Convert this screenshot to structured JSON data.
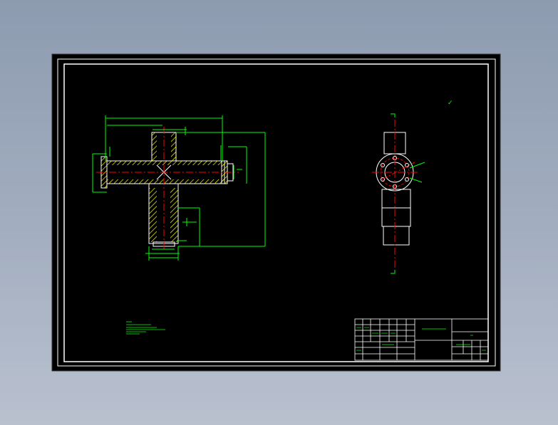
{
  "app": {
    "title": "",
    "background_color": "#95a2b6"
  },
  "drawing": {
    "paper_color": "#000000",
    "colors": {
      "border": "#ffffff",
      "geometry": "#ffffff",
      "dimension": "#00ff00",
      "centerline": "#ff0000",
      "hatch": "#ffff00"
    },
    "title_block": {
      "title_text": "",
      "check_mark": "✓"
    },
    "notes": [
      "",
      "",
      "",
      "",
      "",
      ""
    ]
  }
}
